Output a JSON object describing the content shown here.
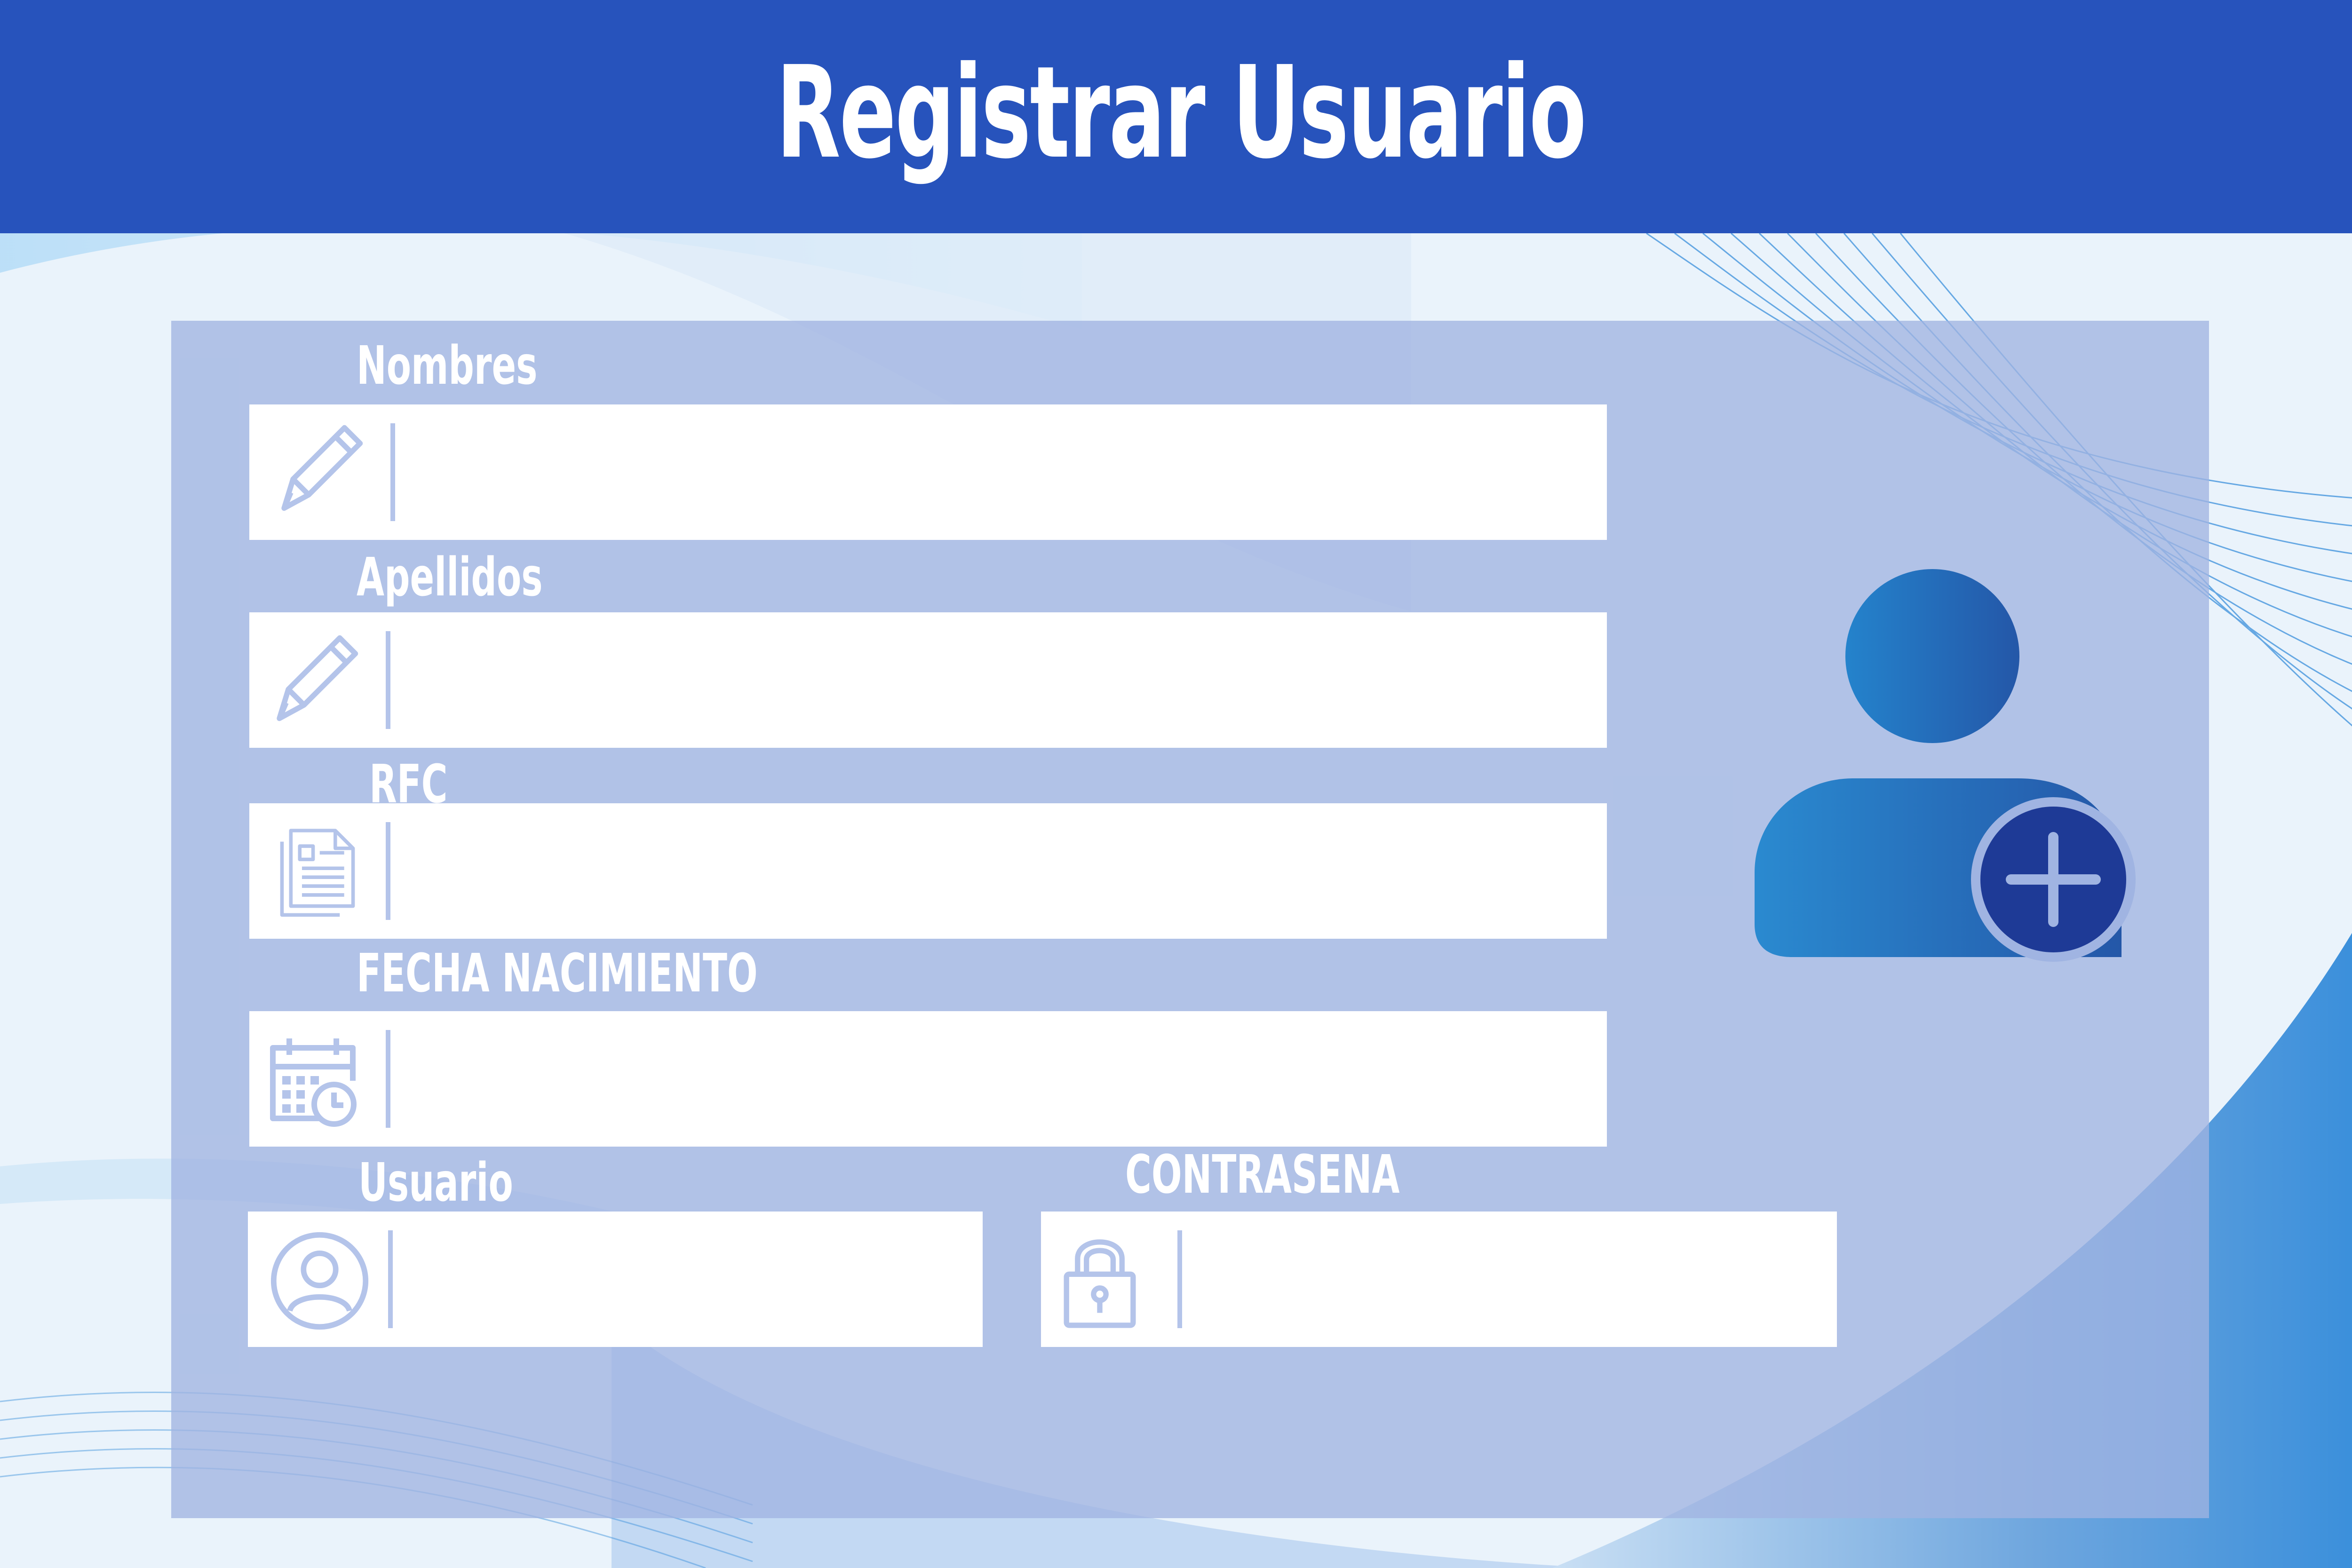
{
  "page": {
    "title": "Registrar Usuario"
  },
  "colors": {
    "header": "#2753bc",
    "panel": "#a0b4e2",
    "field_bg": "#ffffff",
    "icon": "#b4c4ea",
    "avatar_dark": "#1e3a96",
    "avatar_light": "#2483cc"
  },
  "form": {
    "nombres": {
      "label": "Nombres",
      "value": "",
      "icon": "pencil-icon"
    },
    "apellidos": {
      "label": "Apellidos",
      "value": "",
      "icon": "pencil-icon"
    },
    "rfc": {
      "label": "RFC",
      "value": "",
      "icon": "document-icon"
    },
    "fecha_nacimiento": {
      "label": "FECHA NACIMIENTO",
      "value": "",
      "icon": "calendar-clock-icon"
    },
    "usuario": {
      "label": "Usuario",
      "value": "",
      "icon": "user-circle-icon"
    },
    "contrasena": {
      "label": "CONTRASENA",
      "value": "",
      "icon": "lock-icon"
    }
  },
  "avatar": {
    "icon": "add-user-icon"
  }
}
